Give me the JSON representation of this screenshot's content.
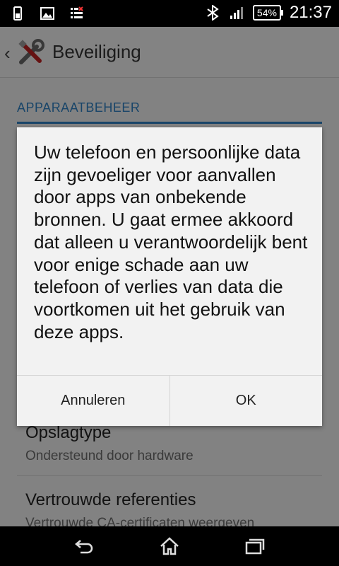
{
  "status_bar": {
    "battery": "54%",
    "time": "21:37"
  },
  "action_bar": {
    "title": "Beveiliging"
  },
  "settings": {
    "section_header": "APPARAATBEHEER",
    "items": [
      {
        "title": "Opslagtype",
        "summary": "Ondersteund door hardware"
      },
      {
        "title": "Vertrouwde referenties",
        "summary": "Vertrouwde CA-certificaten weergeven"
      }
    ]
  },
  "dialog": {
    "message": "Uw telefoon en persoonlijke data zijn gevoeliger voor aanvallen door apps van onbekende bronnen. U gaat ermee akkoord dat alleen u verantwoordelijk bent voor enige schade aan uw telefoon of verlies van data die voortkomen uit het gebruik van deze apps.",
    "cancel_label": "Annuleren",
    "ok_label": "OK"
  },
  "nav_bar": {
    "icons": [
      "back-icon",
      "home-icon",
      "recents-icon"
    ]
  }
}
